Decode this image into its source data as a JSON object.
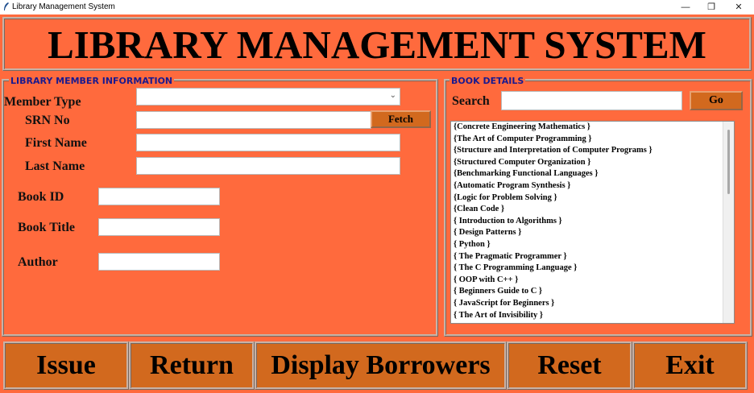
{
  "window": {
    "title": "Library Management System",
    "minimize": "—",
    "restore": "❐",
    "close": "✕"
  },
  "header": {
    "title": "LIBRARY MANAGEMENT SYSTEM"
  },
  "member": {
    "legend": "LIBRARY MEMBER INFORMATION",
    "member_type_label": "Member Type",
    "member_type_value": "",
    "srn_label": "SRN No",
    "srn_value": "",
    "fetch_label": "Fetch",
    "first_name_label": "First Name",
    "first_name_value": "",
    "last_name_label": "Last Name",
    "last_name_value": "",
    "book_id_label": "Book ID",
    "book_id_value": "",
    "book_title_label": "Book Title",
    "book_title_value": "",
    "author_label": "Author",
    "author_value": ""
  },
  "books": {
    "legend": "BOOK DETAILS",
    "search_label": "Search",
    "search_value": "",
    "go_label": "Go",
    "items": [
      "{Concrete Engineering Mathematics }",
      "{The Art of Computer Programming }",
      "{Structure and Interpretation of Computer Programs }",
      "{Structured Computer Organization }",
      "{Benchmarking Functional Languages }",
      "{Automatic Program Synthesis }",
      "{Logic for Problem Solving }",
      "{Clean Code }",
      "{ Introduction to Algorithms }",
      "{ Design Patterns }",
      "{ Python }",
      "{ The Pragmatic Programmer }",
      "{ The C Programming Language }",
      "{ OOP with C++ }",
      "{ Beginners Guide to C }",
      "{ JavaScript for Beginners }",
      "{ The Art of Invisibility }"
    ]
  },
  "actions": {
    "issue": "Issue",
    "return": "Return",
    "display_borrowers": "Display Borrowers",
    "reset": "Reset",
    "exit": "Exit"
  },
  "colors": {
    "background": "#ff6a3d",
    "button": "#d2691e",
    "legend_text": "#1a1a8e"
  }
}
